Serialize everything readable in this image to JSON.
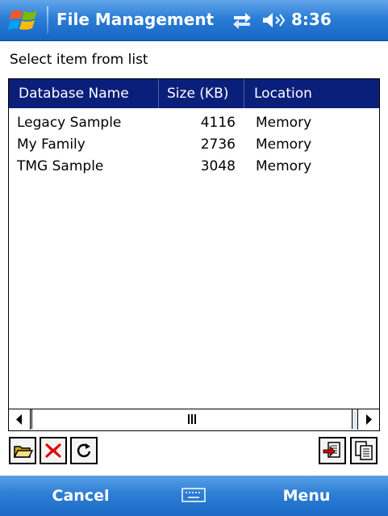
{
  "titlebar": {
    "title": "File Management",
    "time": "8:36",
    "icons": [
      "windows-start-icon",
      "connectivity-icon",
      "volume-icon"
    ]
  },
  "prompt": "Select item from list",
  "list": {
    "columns": [
      "Database Name",
      "Size (KB)",
      "Location"
    ],
    "rows": [
      {
        "name": "Legacy Sample",
        "size": "4116",
        "location": "Memory"
      },
      {
        "name": "My Family",
        "size": "2736",
        "location": "Memory"
      },
      {
        "name": "TMG Sample",
        "size": "3048",
        "location": "Memory"
      }
    ]
  },
  "toolbar": {
    "buttons": [
      "open-folder-icon",
      "delete-icon",
      "refresh-icon",
      "import-icon",
      "copy-document-icon"
    ]
  },
  "softkeys": {
    "left": "Cancel",
    "right": "Menu",
    "center_icon": "keyboard-icon"
  },
  "colors": {
    "titlebar": "#2b7dd6",
    "header_bg": "#0a1f7a",
    "delete_red": "#e00000"
  }
}
